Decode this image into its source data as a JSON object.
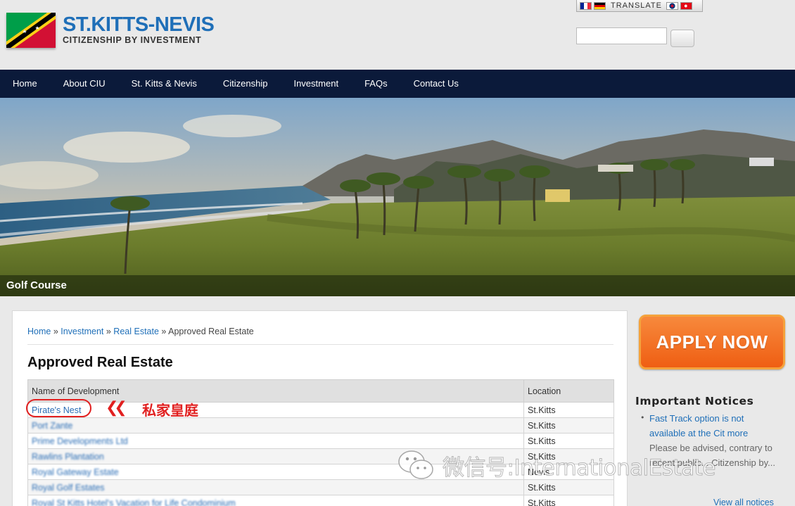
{
  "header": {
    "brand_title": "ST.KITTS-NEVIS",
    "brand_subtitle": "CITIZENSHIP BY INVESTMENT",
    "translate_label": "TRANSLATE",
    "search_placeholder": ""
  },
  "nav": {
    "items": [
      "Home",
      "About CIU",
      "St. Kitts & Nevis",
      "Citizenship",
      "Investment",
      "FAQs",
      "Contact Us"
    ]
  },
  "hero": {
    "caption": "Golf Course"
  },
  "breadcrumb": {
    "home": "Home",
    "sep1": " » ",
    "investment": "Investment",
    "sep2": " » ",
    "real_estate": "Real Estate",
    "sep3": " » ",
    "current": "Approved Real Estate"
  },
  "main": {
    "title": "Approved Real Estate",
    "table": {
      "headers": [
        "Name of Development",
        "Location"
      ],
      "rows": [
        {
          "name": "Pirate's Nest",
          "location": "St.Kitts"
        },
        {
          "name": "Port Zante",
          "location": "St.Kitts"
        },
        {
          "name": "Prime Developments Ltd",
          "location": "St.Kitts"
        },
        {
          "name": "Rawlins Plantation",
          "location": "St.Kitts"
        },
        {
          "name": "Royal Gateway Estate",
          "location": "Nevis"
        },
        {
          "name": "Royal Golf Estates",
          "location": "St.Kitts"
        },
        {
          "name": "Royal St Kitts Hotel's Vacation for Life Condominium",
          "location": "St.Kitts"
        }
      ]
    },
    "annotation": {
      "arrows": "❮❮",
      "text": "私家皇庭"
    }
  },
  "sidebar": {
    "apply_label": "APPLY NOW",
    "notices_title": "Important Notices",
    "notice_link": "Fast Track option is not available at the Cit more",
    "notice_text": "Please be advised, contrary to recent public... Citizenship by...",
    "view_all": "View all notices"
  },
  "watermark": {
    "text": "微信号:InternationalEstate"
  },
  "colors": {
    "nav_bg": "#0b1a3a",
    "brand_blue": "#1f6fb8",
    "apply_orange": "#ef5e13",
    "annotation_red": "#e12020"
  }
}
